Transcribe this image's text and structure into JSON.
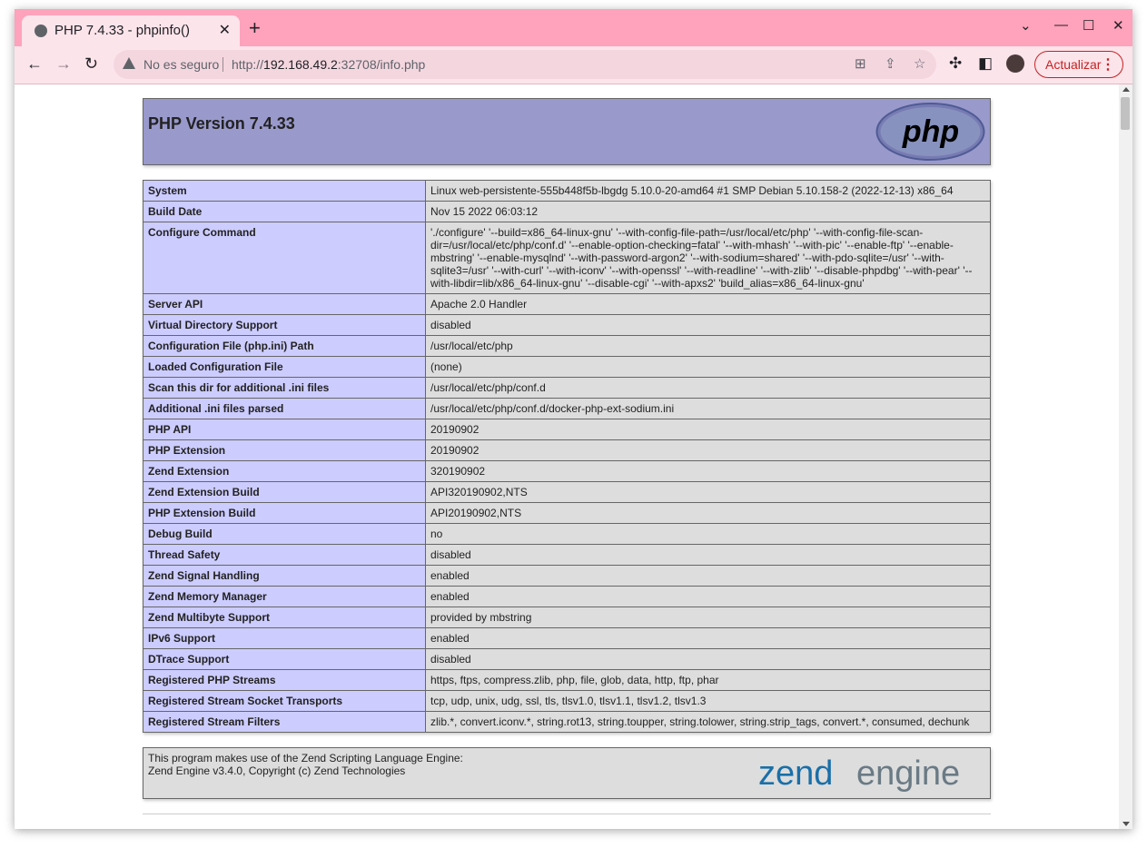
{
  "browser": {
    "tab_title": "PHP 7.4.33 - phpinfo()",
    "tab_close": "✕",
    "new_tab": "+",
    "security_label": "No es seguro",
    "url_scheme": "http://",
    "url_host": "192.168.49.2",
    "url_rest": ":32708/info.php",
    "update_label": "Actualizar",
    "icons": [
      "globe-icon",
      "close-icon",
      "plus-icon",
      "chevron-down-icon",
      "minimize-icon",
      "maximize-icon",
      "close-window-icon",
      "back-icon",
      "forward-icon",
      "reload-icon",
      "warning-icon",
      "translate-icon",
      "share-icon",
      "star-icon",
      "extensions-icon",
      "side-panel-icon",
      "avatar",
      "kebab-menu-icon"
    ]
  },
  "page": {
    "title": "PHP Version 7.4.33",
    "logo_text": "php",
    "rows": [
      {
        "k": "System",
        "v": "Linux web-persistente-555b448f5b-lbgdg 5.10.0-20-amd64 #1 SMP Debian 5.10.158-2 (2022-12-13) x86_64"
      },
      {
        "k": "Build Date",
        "v": "Nov 15 2022 06:03:12"
      },
      {
        "k": "Configure Command",
        "v": "'./configure' '--build=x86_64-linux-gnu' '--with-config-file-path=/usr/local/etc/php' '--with-config-file-scan-dir=/usr/local/etc/php/conf.d' '--enable-option-checking=fatal' '--with-mhash' '--with-pic' '--enable-ftp' '--enable-mbstring' '--enable-mysqlnd' '--with-password-argon2' '--with-sodium=shared' '--with-pdo-sqlite=/usr' '--with-sqlite3=/usr' '--with-curl' '--with-iconv' '--with-openssl' '--with-readline' '--with-zlib' '--disable-phpdbg' '--with-pear' '--with-libdir=lib/x86_64-linux-gnu' '--disable-cgi' '--with-apxs2' 'build_alias=x86_64-linux-gnu'"
      },
      {
        "k": "Server API",
        "v": "Apache 2.0 Handler"
      },
      {
        "k": "Virtual Directory Support",
        "v": "disabled"
      },
      {
        "k": "Configuration File (php.ini) Path",
        "v": "/usr/local/etc/php"
      },
      {
        "k": "Loaded Configuration File",
        "v": "(none)"
      },
      {
        "k": "Scan this dir for additional .ini files",
        "v": "/usr/local/etc/php/conf.d"
      },
      {
        "k": "Additional .ini files parsed",
        "v": "/usr/local/etc/php/conf.d/docker-php-ext-sodium.ini"
      },
      {
        "k": "PHP API",
        "v": "20190902"
      },
      {
        "k": "PHP Extension",
        "v": "20190902"
      },
      {
        "k": "Zend Extension",
        "v": "320190902"
      },
      {
        "k": "Zend Extension Build",
        "v": "API320190902,NTS"
      },
      {
        "k": "PHP Extension Build",
        "v": "API20190902,NTS"
      },
      {
        "k": "Debug Build",
        "v": "no"
      },
      {
        "k": "Thread Safety",
        "v": "disabled"
      },
      {
        "k": "Zend Signal Handling",
        "v": "enabled"
      },
      {
        "k": "Zend Memory Manager",
        "v": "enabled"
      },
      {
        "k": "Zend Multibyte Support",
        "v": "provided by mbstring"
      },
      {
        "k": "IPv6 Support",
        "v": "enabled"
      },
      {
        "k": "DTrace Support",
        "v": "disabled"
      },
      {
        "k": "Registered PHP Streams",
        "v": "https, ftps, compress.zlib, php, file, glob, data, http, ftp, phar"
      },
      {
        "k": "Registered Stream Socket Transports",
        "v": "tcp, udp, unix, udg, ssl, tls, tlsv1.0, tlsv1.1, tlsv1.2, tlsv1.3"
      },
      {
        "k": "Registered Stream Filters",
        "v": "zlib.*, convert.iconv.*, string.rot13, string.toupper, string.tolower, string.strip_tags, convert.*, consumed, dechunk"
      }
    ],
    "zend_line1": "This program makes use of the Zend Scripting Language Engine:",
    "zend_line2": "Zend Engine v3.4.0, Copyright (c) Zend Technologies",
    "zend_logo_word1": "zend",
    "zend_logo_word2": "engine"
  },
  "colors": {
    "tabbar": "#ffa2bb",
    "header_bg": "#9999cc",
    "key_bg": "#ccccff",
    "value_bg": "#dddddd",
    "accent_red": "#c5221f"
  }
}
